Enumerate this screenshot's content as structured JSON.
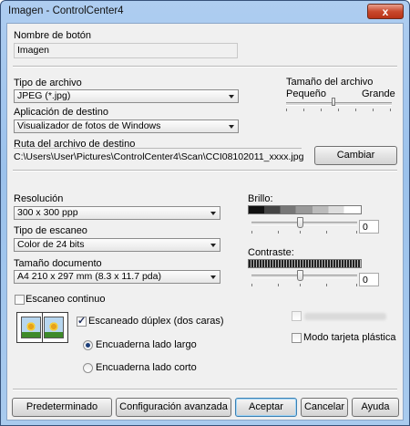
{
  "window": {
    "title": "Imagen - ControlCenter4",
    "close_glyph": "x"
  },
  "button_name": {
    "label": "Nombre de botón",
    "value": "Imagen"
  },
  "file_type": {
    "label": "Tipo de archivo",
    "value": "JPEG (*.jpg)"
  },
  "file_size": {
    "label": "Tamaño del archivo",
    "min_label": "Pequeño",
    "max_label": "Grande"
  },
  "dest_app": {
    "label": "Aplicación de destino",
    "value": "Visualizador de fotos de Windows"
  },
  "dest_path": {
    "label": "Ruta del archivo de destino",
    "value": "C:\\Users\\User\\Pictures\\ControlCenter4\\Scan\\CCI08102011_xxxx.jpg",
    "change_button": "Cambiar"
  },
  "resolution": {
    "label": "Resolución",
    "value": "300 x 300 ppp"
  },
  "scan_type": {
    "label": "Tipo de escaneo",
    "value": "Color de 24 bits"
  },
  "doc_size": {
    "label": "Tamaño documento",
    "value": "A4 210 x 297 mm (8.3 x 11.7 pda)"
  },
  "brightness": {
    "label": "Brillo:",
    "value": "0"
  },
  "contrast": {
    "label": "Contraste:",
    "value": "0"
  },
  "continuous_scan": {
    "label": "Escaneo continuo",
    "checked": false
  },
  "duplex": {
    "label": "Escaneado dúplex (dos caras)",
    "checked": true,
    "long_edge": "Encuaderna lado largo",
    "short_edge": "Encuaderna lado corto",
    "selected": "long"
  },
  "plastic_card": {
    "label": "Modo tarjeta plástica",
    "checked": false
  },
  "footer": {
    "default": "Predeterminado",
    "advanced": "Configuración avanzada",
    "accept": "Aceptar",
    "cancel": "Cancelar",
    "help": "Ayuda"
  }
}
